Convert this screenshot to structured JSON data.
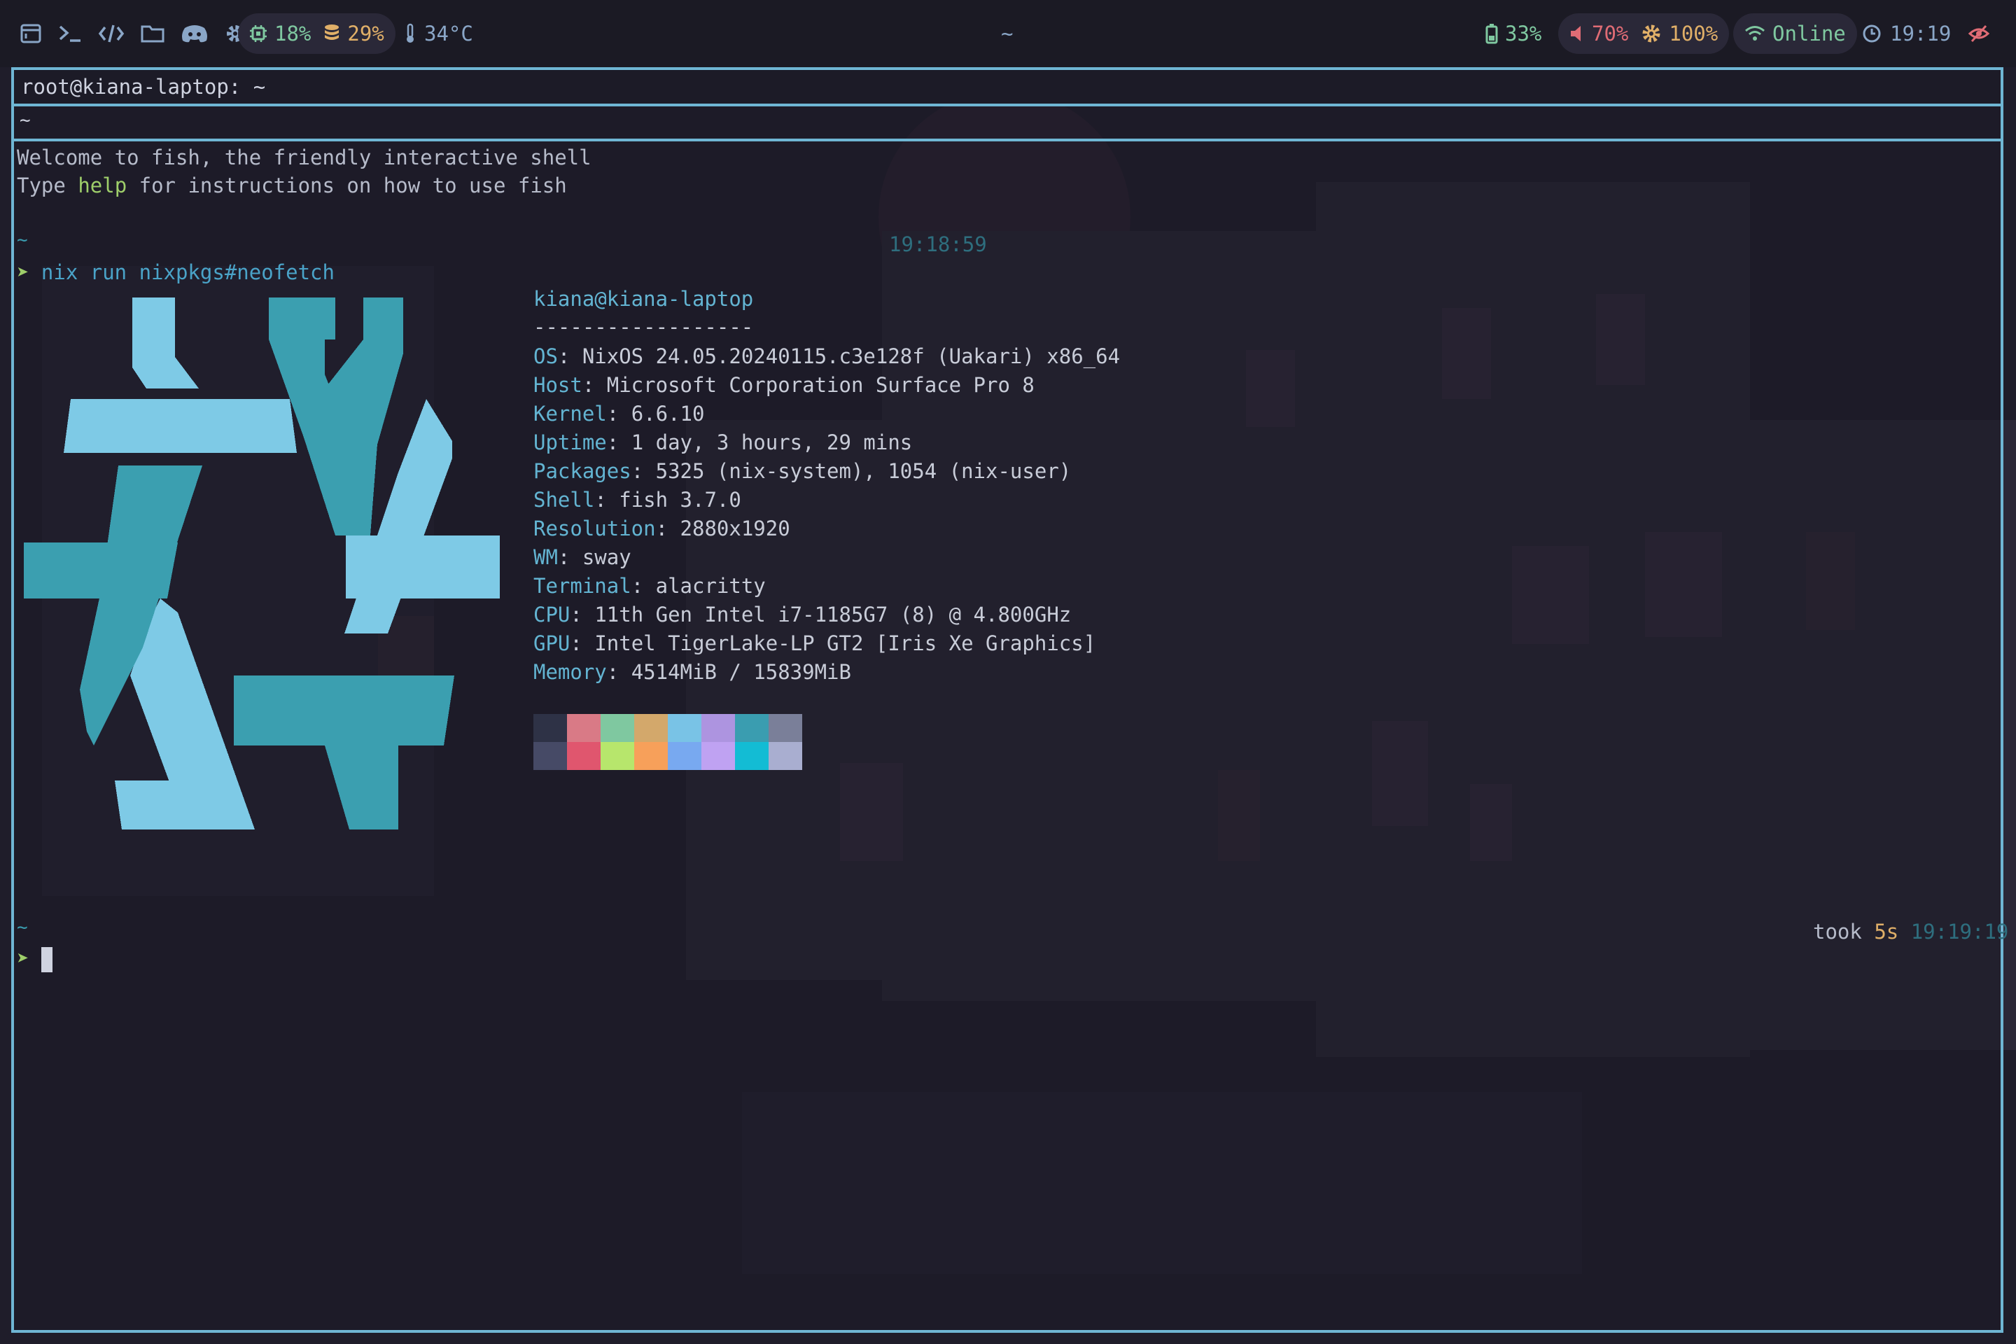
{
  "colors": {
    "accent": "#6fb6d4",
    "logo_light": "#7ecae6",
    "logo_dark": "#3b9fb0",
    "green": "#9ece6a",
    "yellow": "#e0af68",
    "red": "#e06c75"
  },
  "topbar": {
    "launcher_icons": [
      "window-icon",
      "terminal-icon",
      "code-icon",
      "folder-icon",
      "discord-icon",
      "gear-icon"
    ],
    "cpu": "18%",
    "disk": "29%",
    "temp": "34°C",
    "center": "~",
    "battery": "33%",
    "volume": "70%",
    "brightness": "100%",
    "network": "Online",
    "clock": "19:19"
  },
  "terminal": {
    "title": "root@kiana-laptop: ~",
    "path": "~",
    "welcome_1": "Welcome to fish, the friendly interactive shell",
    "welcome_2_pre": "Type ",
    "welcome_2_help": "help",
    "welcome_2_post": " for instructions on how to use fish",
    "prompt_dir_1": "~",
    "prompt_time_1": "19:18:59",
    "command": "nix run nixpkgs#neofetch",
    "prompt_dir_2": "~",
    "took_label": "took ",
    "took_value": "5s",
    "prompt_time_2": "19:19:19"
  },
  "neofetch": {
    "userhost": "kiana@kiana-laptop",
    "separator": "------------------",
    "rows": [
      {
        "key": "OS",
        "value": "NixOS 24.05.20240115.c3e128f (Uakari) x86_64"
      },
      {
        "key": "Host",
        "value": "Microsoft Corporation Surface Pro 8"
      },
      {
        "key": "Kernel",
        "value": "6.6.10"
      },
      {
        "key": "Uptime",
        "value": "1 day, 3 hours, 29 mins"
      },
      {
        "key": "Packages",
        "value": "5325 (nix-system), 1054 (nix-user)"
      },
      {
        "key": "Shell",
        "value": "fish 3.7.0"
      },
      {
        "key": "Resolution",
        "value": "2880x1920"
      },
      {
        "key": "WM",
        "value": "sway"
      },
      {
        "key": "Terminal",
        "value": "alacritty"
      },
      {
        "key": "CPU",
        "value": "11th Gen Intel i7-1185G7 (8) @ 4.800GHz"
      },
      {
        "key": "GPU",
        "value": "Intel TigerLake-LP GT2 [Iris Xe Graphics]"
      },
      {
        "key": "Memory",
        "value": "4514MiB / 15839MiB"
      }
    ],
    "palette_top": [
      "#2e3246",
      "#d97a86",
      "#7fc8a0",
      "#d3a86b",
      "#79c3e6",
      "#ad94e0",
      "#3a9db0",
      "#7a7f99"
    ],
    "palette_bottom": [
      "#464a66",
      "#e0566e",
      "#b7e66c",
      "#f7a05a",
      "#78a9f0",
      "#bfa2f2",
      "#13bcd4",
      "#a9aed0"
    ]
  }
}
